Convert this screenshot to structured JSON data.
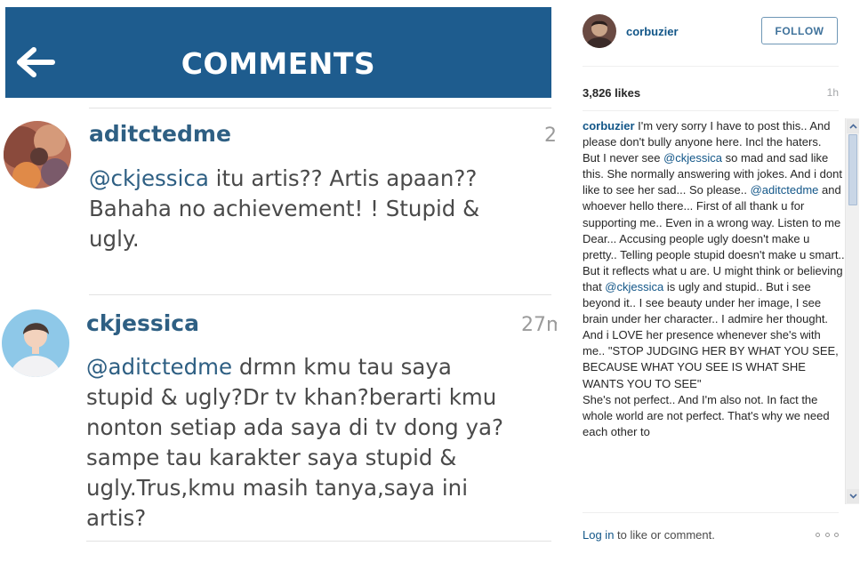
{
  "photo": {
    "header_title": "COMMENTS",
    "comments": [
      {
        "username": "aditctedme",
        "time": "2",
        "mention": "@ckjessica",
        "text": " itu artis?? Artis apaan??\nBahaha no achievement! ! Stupid &\nugly."
      },
      {
        "username": "ckjessica",
        "time": "27m",
        "mention": "@aditctedme",
        "text": " drmn kmu tau saya\nstupid & ugly?Dr tv khan?berarti kmu\nnonton setiap ada saya di tv dong ya?\nsampe tau karakter  saya stupid &\nugly.Trus,kmu masih tanya,saya ini\nartis?"
      }
    ]
  },
  "panel": {
    "username": "corbuzier",
    "follow_label": "FOLLOW",
    "likes": "3,826 likes",
    "age": "1h",
    "caption": {
      "user": "corbuzier",
      "p1": " I'm very sorry I have to post this.. And please don't bully anyone here. Incl the haters.\nBut I never see ",
      "m1": "@ckjessica",
      "p2": " so mad and sad like this. She normally answering with jokes. And i dont like to see her sad... So please.. ",
      "m2": "@aditctedme",
      "p3": " and whoever hello there... First of all thank u for supporting me.. Even in a wrong way. Listen to me Dear... Accusing people ugly doesn't make u pretty.. Telling people stupid doesn't make u smart.. But it reflects what u are. U might think or believing that ",
      "m3": "@ckjessica",
      "p4": " is ugly and stupid.. But i see beyond it.. I see beauty under her image, I see brain under her character.. I admire her thought. And i LOVE her presence whenever she's with me.. \"STOP JUDGING HER BY WHAT YOU SEE, BECAUSE WHAT YOU SEE IS WHAT SHE WANTS YOU TO SEE\"\nShe's not perfect.. And I'm also not. In fact the whole world are not perfect. That's why we need each other to"
    },
    "login_link": "Log in",
    "login_rest": " to like or comment."
  },
  "colors": {
    "header_blue": "#1e5c8e",
    "link_blue": "#125688",
    "comment_user_blue": "#2e5f83"
  },
  "icons": {
    "back": "arrow-left-icon",
    "more": "more-options-icon",
    "scroll_up": "chevron-up-icon",
    "scroll_down": "chevron-down-icon"
  }
}
